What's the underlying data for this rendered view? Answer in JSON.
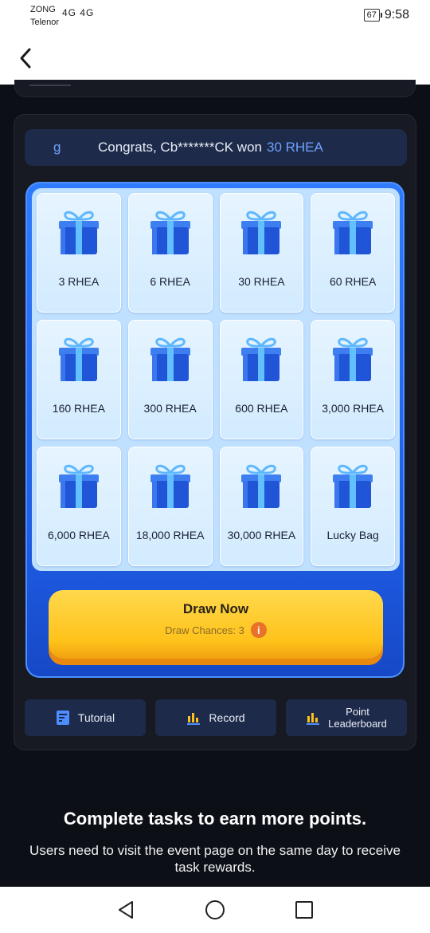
{
  "status_bar": {
    "carrier_1": "ZONG",
    "carrier_2": "Telenor",
    "signal_text": "4G 4G",
    "battery": "67",
    "time": "9:58"
  },
  "ticker": {
    "lead": "g",
    "message": "Congrats, Cb*******CK won",
    "amount": "30 RHEA"
  },
  "prizes": [
    {
      "label": "3 RHEA"
    },
    {
      "label": "6 RHEA"
    },
    {
      "label": "30 RHEA"
    },
    {
      "label": "60 RHEA"
    },
    {
      "label": "160 RHEA"
    },
    {
      "label": "300 RHEA"
    },
    {
      "label": "600 RHEA"
    },
    {
      "label": "3,000 RHEA"
    },
    {
      "label": "6,000 RHEA"
    },
    {
      "label": "18,000 RHEA"
    },
    {
      "label": "30,000 RHEA"
    },
    {
      "label": "Lucky Bag"
    }
  ],
  "draw": {
    "title": "Draw Now",
    "chances": "Draw Chances: 3",
    "info_glyph": "i"
  },
  "actions": {
    "tutorial": "Tutorial",
    "record": "Record",
    "leaderboard_line1": "Point",
    "leaderboard_line2": "Leaderboard"
  },
  "tasks": {
    "title": "Complete tasks to earn more points.",
    "description": "Users need to visit the event page on the same day to receive task rewards."
  },
  "icons": {
    "back": "chevron-left-icon",
    "gift": "gift-box-icon",
    "tutorial": "document-icon",
    "record": "bar-chart-icon",
    "leaderboard": "bar-chart-icon",
    "nav_back": "triangle-back-icon",
    "nav_home": "circle-home-icon",
    "nav_recents": "square-recents-icon"
  },
  "colors": {
    "accent_blue": "#2f7bff",
    "draw_yellow": "#ffc21a",
    "ticker_amount": "#6ea2ff"
  }
}
